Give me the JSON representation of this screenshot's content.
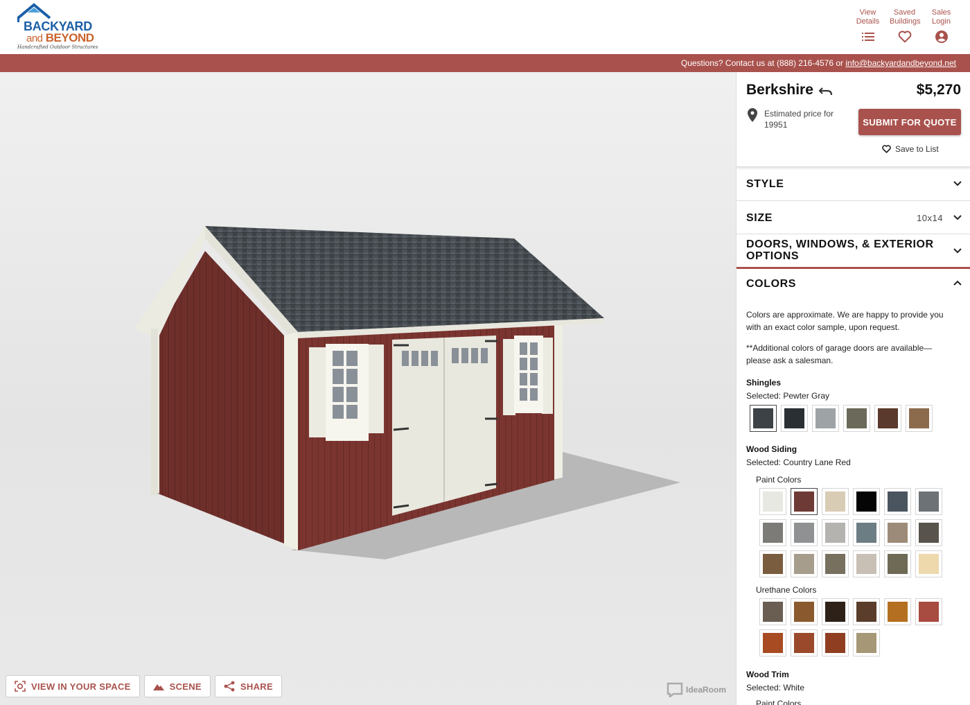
{
  "brand": {
    "line1": "BACKYARD",
    "line2_and": "and",
    "line2": "BEYOND",
    "tagline": "Handcrafted Outdoor Structures"
  },
  "header_links": [
    {
      "label1": "View",
      "label2": "Details",
      "icon": "list-icon"
    },
    {
      "label1": "Saved",
      "label2": "Buildings",
      "icon": "heart-icon"
    },
    {
      "label1": "Sales",
      "label2": "Login",
      "icon": "account-icon"
    }
  ],
  "contact": {
    "text": "Questions? Contact us at (888) 216-4576 or ",
    "email": "info@backyardandbeyond.net"
  },
  "viewer": {
    "buttons": [
      {
        "label": "VIEW IN YOUR SPACE",
        "icon": "ar-icon"
      },
      {
        "label": "SCENE",
        "icon": "mountain-icon"
      },
      {
        "label": "SHARE",
        "icon": "share-icon"
      }
    ],
    "watermark": "IdeaRoom"
  },
  "product": {
    "name": "Berkshire",
    "price": "$5,270",
    "location_text": "Estimated price for 19951",
    "quote_button": "SUBMIT FOR QUOTE",
    "save_label": "Save to List"
  },
  "sections": {
    "style": {
      "label": "STYLE"
    },
    "size": {
      "label": "SIZE",
      "value": "10x14"
    },
    "doors": {
      "label": "DOORS, WINDOWS, & EXTERIOR OPTIONS"
    },
    "colors": {
      "label": "COLORS"
    }
  },
  "colors": {
    "desc1": "Colors are approximate. We are happy to provide you with an exact color sample, upon request.",
    "desc2": "**Additional colors of garage doors are available—please ask a salesman.",
    "shingles": {
      "title": "Shingles",
      "selected": "Selected: Pewter Gray",
      "swatches": [
        "#3c4246",
        "#2a2f33",
        "#9ea3a6",
        "#6b6a5a",
        "#5a3a2c",
        "#8c6b4d"
      ],
      "selected_index": 0
    },
    "wood_siding": {
      "title": "Wood Siding",
      "selected": "Selected: Country Lane Red",
      "paint_title": "Paint Colors",
      "paint": [
        "#e8e8e2",
        "#6e3a35",
        "#d9ccb5",
        "#050505",
        "#4b5560",
        "#6d7276",
        "#7c7b78",
        "#8f9193",
        "#b4b3b0",
        "#6d7d84",
        "#9d8b79",
        "#58534c",
        "#7a5c3f",
        "#a69d8c",
        "#78705f",
        "#c8c0b5",
        "#6e6a55",
        "#eed9ad"
      ],
      "paint_selected_index": 1,
      "urethane_title": "Urethane Colors",
      "urethane": [
        "#6a5d52",
        "#8a5a2e",
        "#2e2218",
        "#5a3e2b",
        "#b56f20",
        "#a84b40",
        "#a84b22",
        "#9a4a2a",
        "#8f3e22",
        "#a69876"
      ]
    },
    "wood_trim": {
      "title": "Wood Trim",
      "selected": "Selected: White",
      "paint_title": "Paint Colors"
    }
  }
}
